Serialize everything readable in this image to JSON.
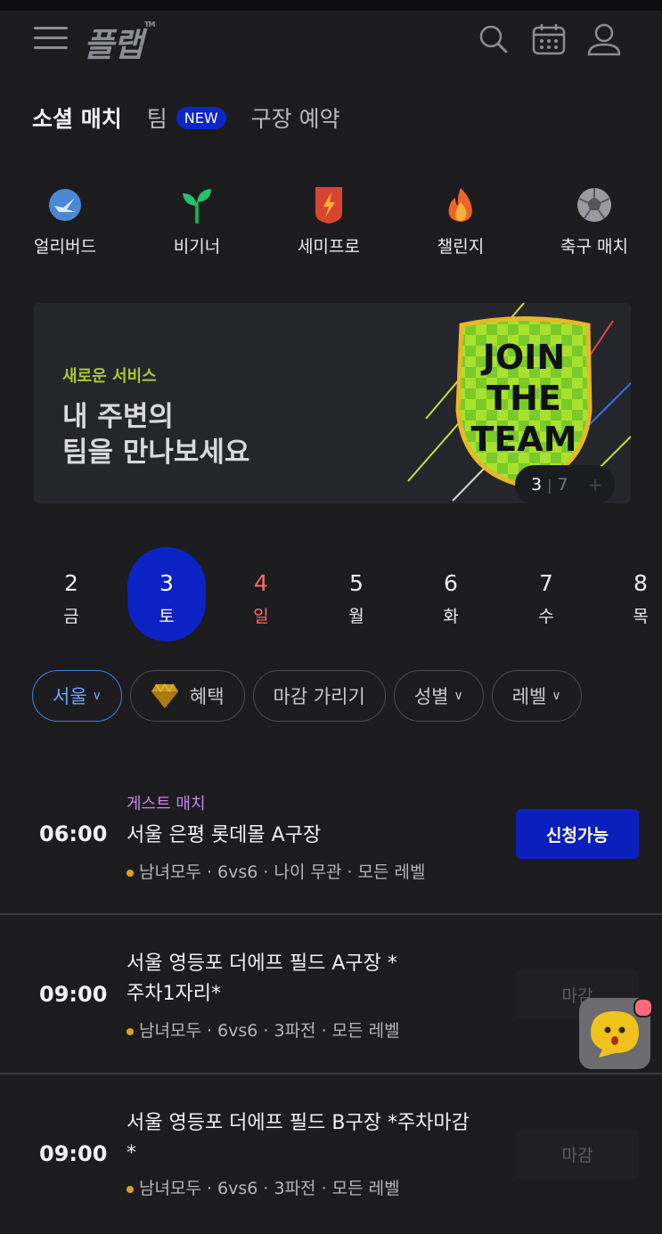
{
  "header": {
    "logo": "플랩",
    "logo_tm": "TM",
    "icons": [
      "menu-icon",
      "search-icon",
      "calendar-icon",
      "user-icon"
    ]
  },
  "tabs": [
    {
      "label": "소셜 매치",
      "active": true
    },
    {
      "label": "팀",
      "badge": "NEW"
    },
    {
      "label": "구장 예약"
    }
  ],
  "categories": [
    {
      "label": "얼리버드",
      "icon": "earlybird-icon"
    },
    {
      "label": "비기너",
      "icon": "sprout-icon"
    },
    {
      "label": "세미프로",
      "icon": "shield-bolt-icon"
    },
    {
      "label": "챌린지",
      "icon": "fire-icon"
    },
    {
      "label": "축구 매치",
      "icon": "soccer-ball-icon"
    }
  ],
  "banner": {
    "subtitle": "새로운 서비스",
    "headline": "내 주변의\n팀을 만나보세요",
    "art_text": [
      "JOIN",
      "THE",
      "TEAM"
    ],
    "page_current": "3",
    "page_total": "7"
  },
  "dates": [
    {
      "day": "2",
      "weekday": "금"
    },
    {
      "day": "3",
      "weekday": "토",
      "selected": true
    },
    {
      "day": "4",
      "weekday": "일",
      "sunday": true
    },
    {
      "day": "5",
      "weekday": "월"
    },
    {
      "day": "6",
      "weekday": "화"
    },
    {
      "day": "7",
      "weekday": "수"
    },
    {
      "day": "8",
      "weekday": "목"
    }
  ],
  "filters": {
    "region": "서울",
    "benefit": "혜택",
    "hide_closed": "마감 가리기",
    "gender": "성별",
    "level": "레벨"
  },
  "matches": [
    {
      "time": "06:00",
      "tag": "게스트 매치",
      "title": "서울 은평 롯데몰 A구장",
      "meta": "남녀모두 · 6vs6 · 나이 무관 · 모든 레벨",
      "status": "신청가능"
    },
    {
      "time": "09:00",
      "title_line1": "서울 영등포 더에프 필드 A구장 *",
      "title_line2": "주차1자리*",
      "meta": "남녀모두 · 6vs6 · 3파전 · 모든 레벨",
      "status": "마감"
    },
    {
      "time": "09:00",
      "title_line1": "서울 영등포 더에프 필드 B구장 *주차마감",
      "title_line2": "*",
      "meta": "남녀모두 · 6vs6 · 3파전 · 모든 레벨",
      "status": "마감"
    }
  ],
  "colors": {
    "background": "#1c1c1e",
    "accent_blue": "#0b22c4",
    "sunday_red": "#ff6b6b",
    "guest_tag_purple": "#c786e8",
    "banner_green": "#a8c832"
  }
}
